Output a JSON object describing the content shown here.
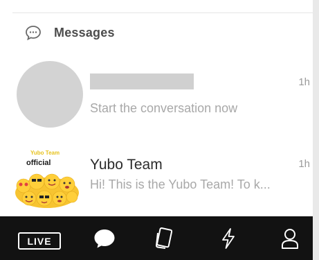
{
  "header": {
    "title": "Messages",
    "icon": "chat-bubble-icon"
  },
  "conversations": [
    {
      "name": "",
      "time": "1h",
      "preview": "Start the conversation now",
      "avatar": "gray-placeholder"
    },
    {
      "name": "Yubo Team",
      "time": "1h",
      "preview": "Hi! This is the Yubo Team! To k...",
      "avatar_brand": "Yubo Team",
      "avatar_label": "official"
    }
  ],
  "bottom_nav": {
    "live_label": "LIVE",
    "items": [
      "live-icon",
      "messages-icon",
      "cards-icon",
      "lightning-icon",
      "profile-icon"
    ]
  },
  "colors": {
    "nav_background": "#121212",
    "nav_foreground": "#ffffff",
    "placeholder_gray": "#d3d3d3",
    "brand_yellow": "#e7c21e"
  }
}
